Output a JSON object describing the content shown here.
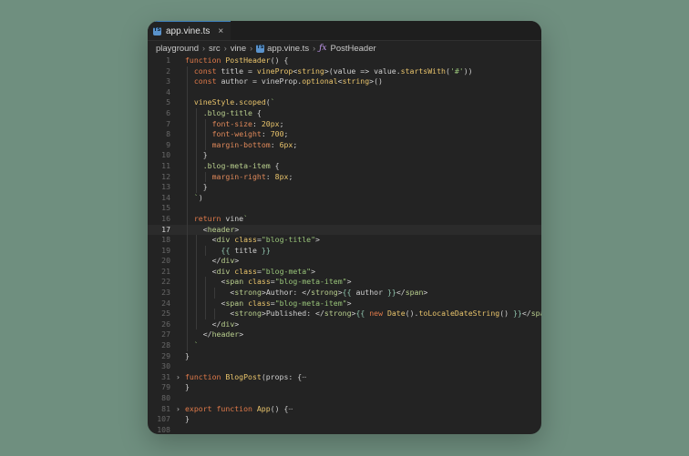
{
  "tab": {
    "badge": "TS",
    "name": "app.vine.ts",
    "close": "×"
  },
  "breadcrumb": {
    "items": [
      "playground",
      "src",
      "vine"
    ],
    "file_badge": "TS",
    "file": "app.vine.ts",
    "fx_icon": "ƒx",
    "symbol": "PostHeader"
  },
  "current_line": 17,
  "lines": [
    {
      "n": "1",
      "indent": 0,
      "guides": [],
      "tokens": [
        [
          "kw",
          "function "
        ],
        [
          "fn",
          "PostHeader"
        ],
        [
          "pn",
          "() {"
        ]
      ]
    },
    {
      "n": "2",
      "indent": 1,
      "guides": [
        1
      ],
      "tokens": [
        [
          "kw",
          "const "
        ],
        [
          "pn",
          "title = "
        ],
        [
          "fn",
          "vineProp"
        ],
        [
          "pn",
          "<"
        ],
        [
          "ty",
          "string"
        ],
        [
          "pn",
          ">(value => value."
        ],
        [
          "fn",
          "startsWith"
        ],
        [
          "pn",
          "("
        ],
        [
          "str",
          "'#'"
        ],
        [
          "pn",
          "))"
        ]
      ]
    },
    {
      "n": "3",
      "indent": 1,
      "guides": [
        1
      ],
      "tokens": [
        [
          "kw",
          "const "
        ],
        [
          "pn",
          "author = vineProp."
        ],
        [
          "fn",
          "optional"
        ],
        [
          "pn",
          "<"
        ],
        [
          "ty",
          "string"
        ],
        [
          "pn",
          ">()"
        ]
      ]
    },
    {
      "n": "4",
      "indent": 0,
      "guides": [
        1
      ],
      "tokens": []
    },
    {
      "n": "5",
      "indent": 1,
      "guides": [
        1
      ],
      "tokens": [
        [
          "fn",
          "vineStyle"
        ],
        [
          "pn",
          "."
        ],
        [
          "fn",
          "scoped"
        ],
        [
          "pn",
          "("
        ],
        [
          "str",
          "`"
        ]
      ]
    },
    {
      "n": "6",
      "indent": 2,
      "guides": [
        1,
        2
      ],
      "tokens": [
        [
          "sel",
          ".blog-title "
        ],
        [
          "pn",
          "{"
        ]
      ]
    },
    {
      "n": "7",
      "indent": 3,
      "guides": [
        1,
        2,
        3
      ],
      "tokens": [
        [
          "prop",
          "font-size"
        ],
        [
          "pn",
          ": "
        ],
        [
          "num",
          "20px"
        ],
        [
          "pn",
          ";"
        ]
      ]
    },
    {
      "n": "8",
      "indent": 3,
      "guides": [
        1,
        2,
        3
      ],
      "tokens": [
        [
          "prop",
          "font-weight"
        ],
        [
          "pn",
          ": "
        ],
        [
          "num",
          "700"
        ],
        [
          "pn",
          ";"
        ]
      ]
    },
    {
      "n": "9",
      "indent": 3,
      "guides": [
        1,
        2,
        3
      ],
      "tokens": [
        [
          "prop",
          "margin-bottom"
        ],
        [
          "pn",
          ": "
        ],
        [
          "num",
          "6px"
        ],
        [
          "pn",
          ";"
        ]
      ]
    },
    {
      "n": "10",
      "indent": 2,
      "guides": [
        1,
        2
      ],
      "tokens": [
        [
          "pn",
          "}"
        ]
      ]
    },
    {
      "n": "11",
      "indent": 2,
      "guides": [
        1,
        2
      ],
      "tokens": [
        [
          "sel",
          ".blog-meta-item "
        ],
        [
          "pn",
          "{"
        ]
      ]
    },
    {
      "n": "12",
      "indent": 3,
      "guides": [
        1,
        2,
        3
      ],
      "tokens": [
        [
          "prop",
          "margin-right"
        ],
        [
          "pn",
          ": "
        ],
        [
          "num",
          "8px"
        ],
        [
          "pn",
          ";"
        ]
      ]
    },
    {
      "n": "13",
      "indent": 2,
      "guides": [
        1,
        2
      ],
      "tokens": [
        [
          "pn",
          "}"
        ]
      ]
    },
    {
      "n": "14",
      "indent": 1,
      "guides": [
        1
      ],
      "tokens": [
        [
          "str",
          "`"
        ],
        [
          "pn",
          ")"
        ]
      ]
    },
    {
      "n": "15",
      "indent": 0,
      "guides": [
        1
      ],
      "tokens": []
    },
    {
      "n": "16",
      "indent": 1,
      "guides": [
        1
      ],
      "tokens": [
        [
          "kw",
          "return "
        ],
        [
          "pn",
          "vine"
        ],
        [
          "str",
          "`"
        ]
      ]
    },
    {
      "n": "17",
      "indent": 2,
      "guides": [
        1
      ],
      "tokens": [
        [
          "pn",
          "<"
        ],
        [
          "tag",
          "header"
        ],
        [
          "pn",
          ">"
        ]
      ]
    },
    {
      "n": "18",
      "indent": 3,
      "guides": [
        1,
        2
      ],
      "tokens": [
        [
          "pn",
          "<"
        ],
        [
          "tag",
          "div "
        ],
        [
          "attr",
          "class"
        ],
        [
          "pn",
          "="
        ],
        [
          "str",
          "\"blog-title\""
        ],
        [
          "pn",
          ">"
        ]
      ]
    },
    {
      "n": "19",
      "indent": 4,
      "guides": [
        1,
        2,
        3
      ],
      "tokens": [
        [
          "tpl",
          "{{ "
        ],
        [
          "pn",
          "title"
        ],
        [
          "tpl",
          " }}"
        ]
      ]
    },
    {
      "n": "20",
      "indent": 3,
      "guides": [
        1,
        2
      ],
      "tokens": [
        [
          "pn",
          "</"
        ],
        [
          "tag",
          "div"
        ],
        [
          "pn",
          ">"
        ]
      ]
    },
    {
      "n": "21",
      "indent": 3,
      "guides": [
        1,
        2
      ],
      "tokens": [
        [
          "pn",
          "<"
        ],
        [
          "tag",
          "div "
        ],
        [
          "attr",
          "class"
        ],
        [
          "pn",
          "="
        ],
        [
          "str",
          "\"blog-meta\""
        ],
        [
          "pn",
          ">"
        ]
      ]
    },
    {
      "n": "22",
      "indent": 4,
      "guides": [
        1,
        2,
        3
      ],
      "tokens": [
        [
          "pn",
          "<"
        ],
        [
          "tag",
          "span "
        ],
        [
          "attr",
          "class"
        ],
        [
          "pn",
          "="
        ],
        [
          "str",
          "\"blog-meta-item\""
        ],
        [
          "pn",
          ">"
        ]
      ]
    },
    {
      "n": "23",
      "indent": 5,
      "guides": [
        1,
        2,
        3,
        4
      ],
      "tokens": [
        [
          "pn",
          "<"
        ],
        [
          "tag",
          "strong"
        ],
        [
          "pn",
          ">Author: </"
        ],
        [
          "tag",
          "strong"
        ],
        [
          "pn",
          ">"
        ],
        [
          "tpl",
          "{{ "
        ],
        [
          "pn",
          "author"
        ],
        [
          "tpl",
          " }}"
        ],
        [
          "pn",
          "</"
        ],
        [
          "tag",
          "span"
        ],
        [
          "pn",
          ">"
        ]
      ]
    },
    {
      "n": "24",
      "indent": 4,
      "guides": [
        1,
        2,
        3
      ],
      "tokens": [
        [
          "pn",
          "<"
        ],
        [
          "tag",
          "span "
        ],
        [
          "attr",
          "class"
        ],
        [
          "pn",
          "="
        ],
        [
          "str",
          "\"blog-meta-item\""
        ],
        [
          "pn",
          ">"
        ]
      ]
    },
    {
      "n": "25",
      "indent": 5,
      "guides": [
        1,
        2,
        3,
        4
      ],
      "tokens": [
        [
          "pn",
          "<"
        ],
        [
          "tag",
          "strong"
        ],
        [
          "pn",
          ">Published: </"
        ],
        [
          "tag",
          "strong"
        ],
        [
          "pn",
          ">"
        ],
        [
          "tpl",
          "{{ "
        ],
        [
          "kw",
          "new "
        ],
        [
          "fn",
          "Date"
        ],
        [
          "pn",
          "()."
        ],
        [
          "fn",
          "toLocaleDateString"
        ],
        [
          "pn",
          "()"
        ],
        [
          "tpl",
          " }}"
        ],
        [
          "pn",
          "</"
        ],
        [
          "tag",
          "span"
        ],
        [
          "pn",
          ">"
        ]
      ]
    },
    {
      "n": "26",
      "indent": 3,
      "guides": [
        1,
        2
      ],
      "tokens": [
        [
          "pn",
          "</"
        ],
        [
          "tag",
          "div"
        ],
        [
          "pn",
          ">"
        ]
      ]
    },
    {
      "n": "27",
      "indent": 2,
      "guides": [
        1
      ],
      "tokens": [
        [
          "pn",
          "</"
        ],
        [
          "tag",
          "header"
        ],
        [
          "pn",
          ">"
        ]
      ]
    },
    {
      "n": "28",
      "indent": 1,
      "guides": [
        1
      ],
      "tokens": [
        [
          "str",
          "`"
        ]
      ]
    },
    {
      "n": "29",
      "indent": 0,
      "guides": [],
      "tokens": [
        [
          "pn",
          "}"
        ]
      ]
    },
    {
      "n": "30",
      "indent": 0,
      "guides": [],
      "tokens": []
    },
    {
      "n": "31",
      "indent": 0,
      "guides": [],
      "fold": "›",
      "tokens": [
        [
          "kw",
          "function "
        ],
        [
          "fn",
          "BlogPost"
        ],
        [
          "pn",
          "(props: {"
        ],
        [
          "dots",
          "⋯"
        ]
      ]
    },
    {
      "n": "79",
      "indent": 0,
      "guides": [],
      "tokens": [
        [
          "pn",
          "}"
        ]
      ]
    },
    {
      "n": "80",
      "indent": 0,
      "guides": [],
      "tokens": []
    },
    {
      "n": "81",
      "indent": 0,
      "guides": [],
      "fold": "›",
      "tokens": [
        [
          "kw",
          "export function "
        ],
        [
          "fn",
          "App"
        ],
        [
          "pn",
          "() {"
        ],
        [
          "dots",
          "⋯"
        ]
      ]
    },
    {
      "n": "107",
      "indent": 0,
      "guides": [],
      "tokens": [
        [
          "pn",
          "}"
        ]
      ]
    },
    {
      "n": "108",
      "indent": 0,
      "guides": [],
      "tokens": []
    }
  ]
}
